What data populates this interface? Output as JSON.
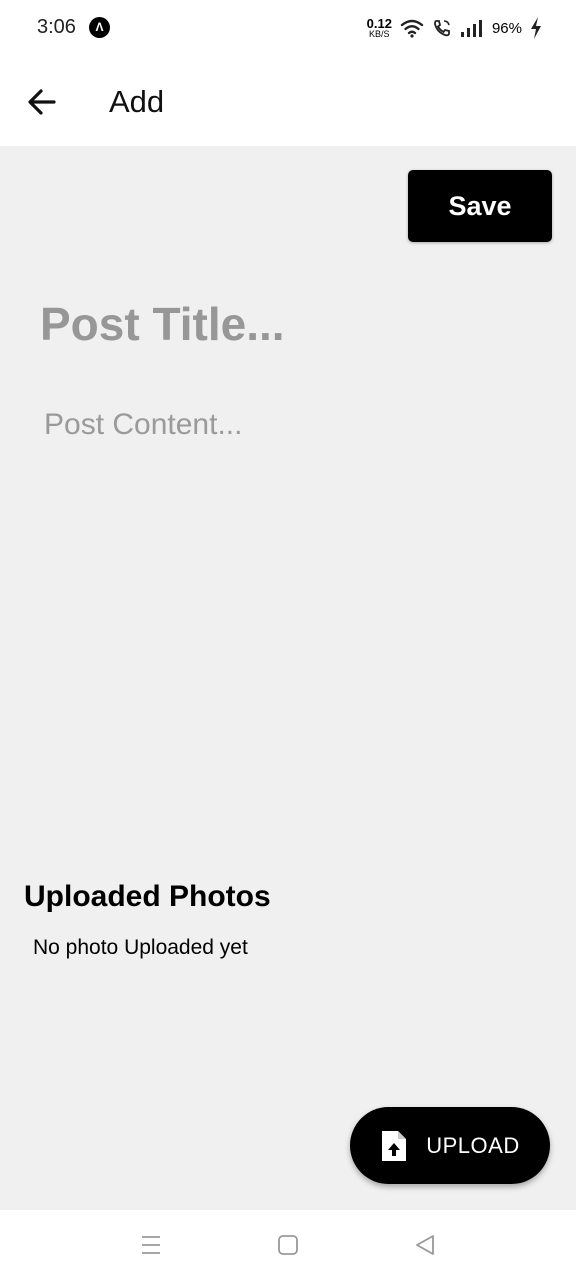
{
  "status_bar": {
    "time": "3:06",
    "app_icon_glyph": "Λ",
    "net_speed_value": "0.12",
    "net_speed_unit": "KB/S",
    "battery_percent": "96%",
    "icons": [
      "wifi-icon",
      "wifi-call-icon",
      "signal-icon",
      "charging-icon"
    ]
  },
  "app_bar": {
    "title": "Add",
    "back_icon": "arrow-left-icon"
  },
  "editor": {
    "save_label": "Save",
    "title_placeholder": "Post Title...",
    "title_value": "",
    "content_placeholder": "Post Content...",
    "content_value": ""
  },
  "photos": {
    "heading": "Uploaded Photos",
    "empty_message": "No photo Uploaded yet"
  },
  "upload": {
    "label": "UPLOAD",
    "icon": "file-upload-icon"
  },
  "nav_bar": {
    "icons": [
      "menu-icon",
      "home-icon",
      "back-triangle-icon"
    ]
  },
  "colors": {
    "background": "#f0f0f0",
    "surface": "#ffffff",
    "primary": "#000000",
    "placeholder": "#979797"
  }
}
